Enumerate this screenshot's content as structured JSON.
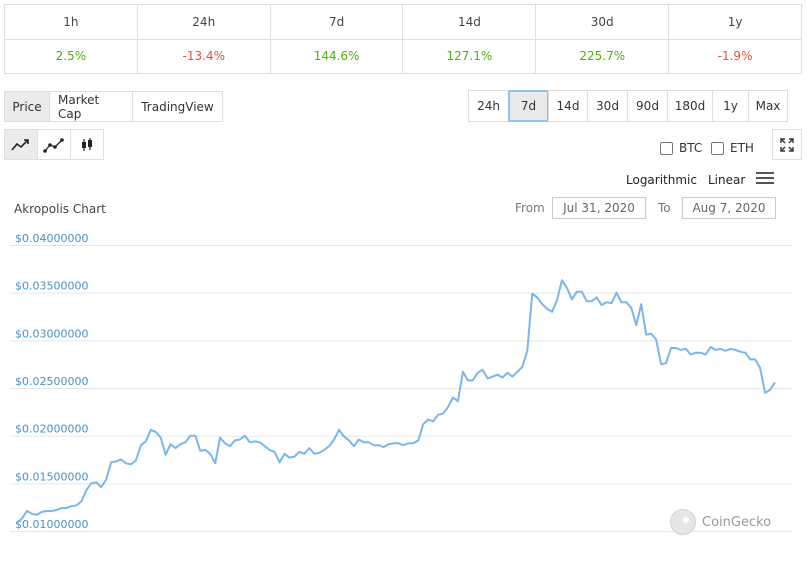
{
  "change_table": {
    "headers": [
      "1h",
      "24h",
      "7d",
      "14d",
      "30d",
      "1y"
    ],
    "values": [
      {
        "text": "2.5%",
        "dir": "pos"
      },
      {
        "text": "-13.4%",
        "dir": "neg"
      },
      {
        "text": "144.6%",
        "dir": "pos"
      },
      {
        "text": "127.1%",
        "dir": "pos"
      },
      {
        "text": "225.7%",
        "dir": "pos"
      },
      {
        "text": "-1.9%",
        "dir": "neg"
      }
    ]
  },
  "chart_types": [
    "Price",
    "Market Cap",
    "TradingView"
  ],
  "ranges": [
    "24h",
    "7d",
    "14d",
    "30d",
    "90d",
    "180d",
    "1y",
    "Max"
  ],
  "selected_range": "7d",
  "selected_chart_type": "Price",
  "chart_styles": [
    "line-chart-icon",
    "line-markers-chart-icon",
    "candlestick-chart-icon"
  ],
  "compare": {
    "btc": "BTC",
    "eth": "ETH"
  },
  "scale": {
    "log": "Logarithmic",
    "linear": "Linear"
  },
  "chart_title": "Akropolis Chart",
  "range": {
    "from_label": "From",
    "from": "Jul 31, 2020",
    "to_label": "To",
    "to": "Aug 7, 2020"
  },
  "watermark": "CoinGecko",
  "colors": {
    "positive": "#4eaf0a",
    "negative": "#e15241",
    "line": "#7cb5ec",
    "axis_label": "#4a90c8"
  },
  "chart_data": {
    "type": "line",
    "title": "Akropolis Chart",
    "ylim": [
      0.01,
      0.04
    ],
    "y_ticks": [
      "$0.04000000",
      "$0.03500000",
      "$0.03000000",
      "$0.02500000",
      "$0.02000000",
      "$0.01500000",
      "$0.01000000"
    ],
    "y_tick_values": [
      0.04,
      0.035,
      0.03,
      0.025,
      0.02,
      0.015,
      0.01
    ],
    "x_range": [
      "Jul 31, 2020",
      "Aug 7, 2020"
    ],
    "grid": true,
    "series": [
      {
        "values": [
          0.0109,
          0.0113,
          0.0121,
          0.0118,
          0.0117,
          0.012,
          0.0121,
          0.0121,
          0.0122,
          0.0124,
          0.0124,
          0.0126,
          0.0127,
          0.0131,
          0.0143,
          0.015,
          0.0151,
          0.0146,
          0.0154,
          0.0172,
          0.0173,
          0.0175,
          0.0171,
          0.017,
          0.0174,
          0.019,
          0.0194,
          0.0206,
          0.0204,
          0.0198,
          0.018,
          0.0191,
          0.0187,
          0.0191,
          0.0193,
          0.02,
          0.02,
          0.0184,
          0.0185,
          0.0181,
          0.0171,
          0.0198,
          0.0192,
          0.0189,
          0.0195,
          0.0196,
          0.02,
          0.0193,
          0.0194,
          0.0193,
          0.0189,
          0.0185,
          0.0183,
          0.0172,
          0.0181,
          0.0177,
          0.0178,
          0.0183,
          0.0181,
          0.0187,
          0.0181,
          0.0182,
          0.0185,
          0.0189,
          0.0196,
          0.0206,
          0.0199,
          0.0195,
          0.0189,
          0.0196,
          0.0193,
          0.0193,
          0.019,
          0.019,
          0.0188,
          0.0191,
          0.0192,
          0.0192,
          0.019,
          0.0192,
          0.0192,
          0.0195,
          0.0212,
          0.0217,
          0.0215,
          0.0222,
          0.0223,
          0.023,
          0.024,
          0.0236,
          0.0267,
          0.0258,
          0.0258,
          0.0266,
          0.0269,
          0.026,
          0.0262,
          0.0264,
          0.0261,
          0.0266,
          0.0262,
          0.0267,
          0.0272,
          0.0289,
          0.0349,
          0.0345,
          0.0338,
          0.0333,
          0.033,
          0.0342,
          0.0363,
          0.0355,
          0.0343,
          0.0351,
          0.0351,
          0.0341,
          0.0341,
          0.0345,
          0.0337,
          0.034,
          0.0339,
          0.035,
          0.034,
          0.034,
          0.0334,
          0.0316,
          0.0338,
          0.0306,
          0.0307,
          0.0301,
          0.0275,
          0.0276,
          0.0292,
          0.0292,
          0.029,
          0.0291,
          0.0285,
          0.0287,
          0.0287,
          0.0285,
          0.0293,
          0.029,
          0.0291,
          0.0289,
          0.0291,
          0.029,
          0.0288,
          0.0287,
          0.028,
          0.028,
          0.0271,
          0.0245,
          0.0248,
          0.0256
        ]
      }
    ]
  }
}
